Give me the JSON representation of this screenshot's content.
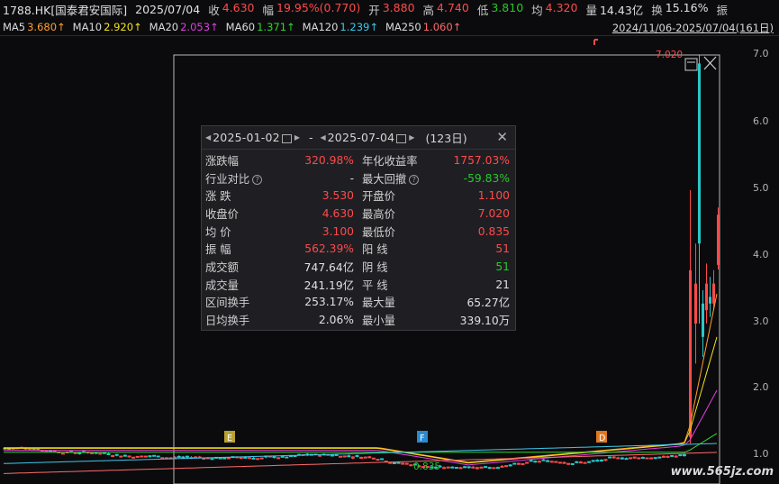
{
  "quote": {
    "symbol": "1788.HK[国泰君安国际]",
    "date": "2025/07/04",
    "close_label": "收",
    "close": "4.630",
    "change_label": "幅",
    "change": "19.95%(0.770)",
    "open_label": "开",
    "open": "3.880",
    "high_label": "高",
    "high": "4.740",
    "low_label": "低",
    "low": "3.810",
    "avg_label": "均",
    "avg": "4.320",
    "volume_label": "量",
    "volume": "14.43亿",
    "turnover_label": "换",
    "turnover": "15.16%",
    "amplitude_label": "振"
  },
  "ma": [
    {
      "name": "MA5",
      "value": "3.680↑",
      "color": "#ffffff",
      "vcolor": "#ff9f2a"
    },
    {
      "name": "MA10",
      "value": "2.920↑",
      "color": "#ffffff",
      "vcolor": "#f0e020"
    },
    {
      "name": "MA20",
      "value": "2.053↑",
      "color": "#ffffff",
      "vcolor": "#e040e0"
    },
    {
      "name": "MA60",
      "value": "1.371↑",
      "color": "#ffffff",
      "vcolor": "#30d830"
    },
    {
      "name": "MA120",
      "value": "1.239↑",
      "color": "#ffffff",
      "vcolor": "#40c8e8"
    },
    {
      "name": "MA250",
      "value": "1.060↑",
      "color": "#ffffff",
      "vcolor": "#ff6a6a"
    }
  ],
  "range_text": "2024/11/06-2025/07/04(161日)",
  "yaxis": [
    "7.0",
    "6.0",
    "5.0",
    "4.0",
    "3.0",
    "2.0",
    "1.0"
  ],
  "max_price_label": "7.020",
  "min_price_label": "0.835",
  "markers": [
    "E",
    "F",
    "D"
  ],
  "popup": {
    "start_date": "2025-01-02",
    "end_date": "2025-07-04",
    "dash": "-",
    "days": "(123日)",
    "rows": [
      {
        "k": "涨跌幅",
        "v": "320.98%",
        "vc": "red",
        "k2": "年化收益率",
        "v2": "1757.03%",
        "v2c": "red"
      },
      {
        "k": "行业对比",
        "q": true,
        "v": "-",
        "vc": "white",
        "k2": "最大回撤",
        "q2": true,
        "v2": "-59.83%",
        "v2c": "green"
      },
      {
        "k": "涨  跌",
        "v": "3.530",
        "vc": "red",
        "k2": "开盘价",
        "v2": "1.100",
        "v2c": "red"
      },
      {
        "k": "收盘价",
        "v": "4.630",
        "vc": "red",
        "k2": "最高价",
        "v2": "7.020",
        "v2c": "red"
      },
      {
        "k": "均  价",
        "v": "3.100",
        "vc": "red",
        "k2": "最低价",
        "v2": "0.835",
        "v2c": "red"
      },
      {
        "k": "振  幅",
        "v": "562.39%",
        "vc": "red",
        "k2": "阳  线",
        "v2": "51",
        "v2c": "red"
      },
      {
        "k": "成交额",
        "v": "747.64亿",
        "vc": "white",
        "k2": "阴  线",
        "v2": "51",
        "v2c": "green"
      },
      {
        "k": "成交量",
        "v": "241.19亿",
        "vc": "white",
        "k2": "平  线",
        "v2": "21",
        "v2c": "white"
      },
      {
        "k": "区间换手",
        "v": "253.17%",
        "vc": "white",
        "k2": "最大量",
        "v2": "65.27亿",
        "v2c": "white"
      },
      {
        "k": "日均换手",
        "v": "2.06%",
        "vc": "white",
        "k2": "最小量",
        "v2": "339.10万",
        "v2c": "white"
      }
    ]
  },
  "watermark": "www.565jz.com"
}
